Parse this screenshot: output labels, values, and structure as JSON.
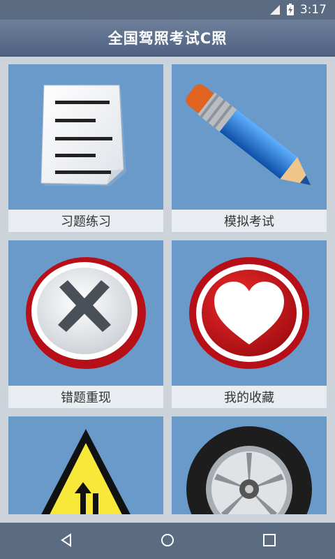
{
  "status_bar": {
    "time": "3:17",
    "icons": [
      "signal-icon",
      "battery-charging-icon"
    ]
  },
  "app_bar": {
    "title": "全国驾照考试C照"
  },
  "menu": {
    "items": [
      {
        "label": "习题练习",
        "icon": "document-icon"
      },
      {
        "label": "模拟考试",
        "icon": "pencil-icon"
      },
      {
        "label": "错题重现",
        "icon": "x-mark-icon"
      },
      {
        "label": "我的收藏",
        "icon": "heart-icon"
      },
      {
        "label": "",
        "icon": "traffic-warning-sign-icon"
      },
      {
        "label": "",
        "icon": "tire-icon"
      }
    ]
  },
  "nav_bar": {
    "buttons": [
      "back-icon",
      "home-icon",
      "recents-icon"
    ]
  }
}
